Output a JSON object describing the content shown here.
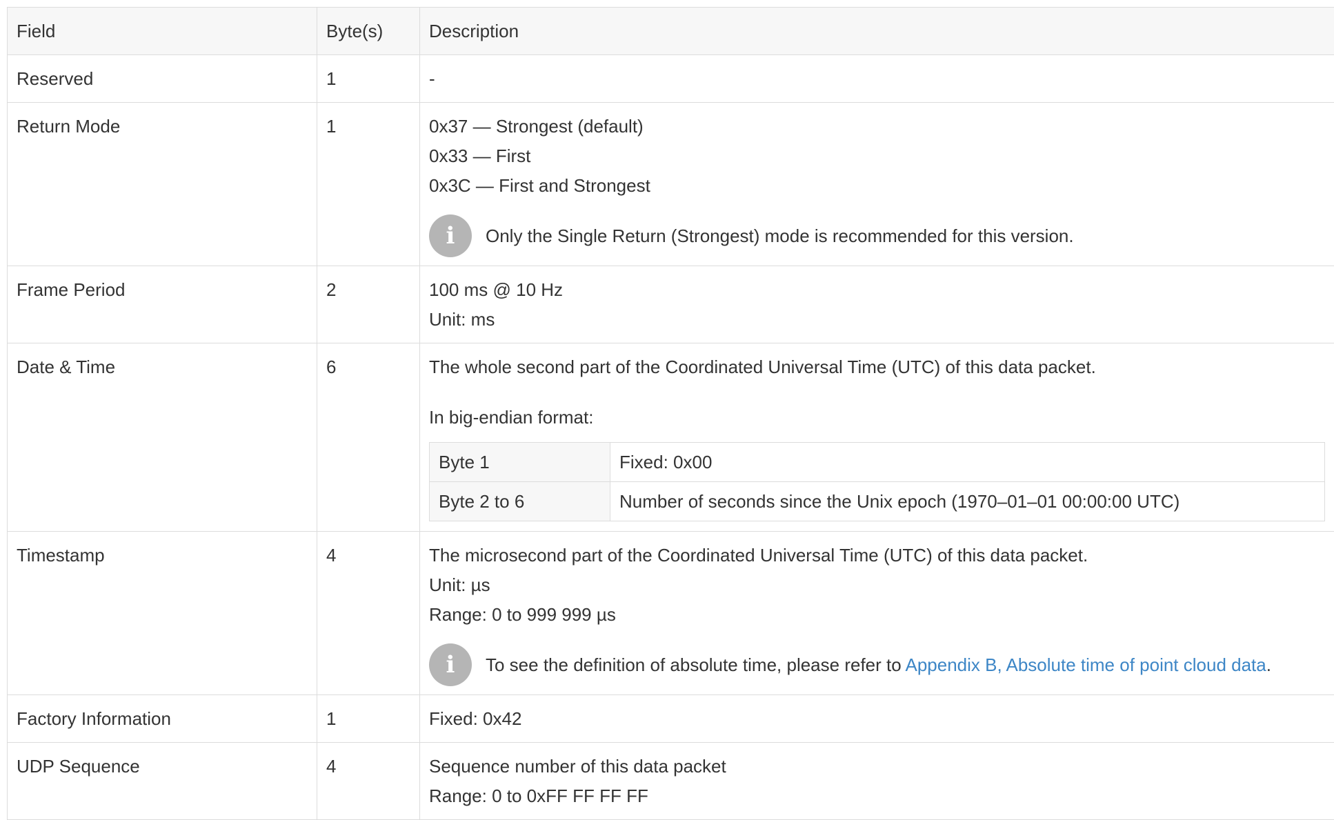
{
  "table": {
    "headers": {
      "field": "Field",
      "bytes": "Byte(s)",
      "description": "Description"
    },
    "rows": {
      "reserved": {
        "field": "Reserved",
        "bytes": "1",
        "description": "-"
      },
      "return_mode": {
        "field": "Return Mode",
        "bytes": "1",
        "lines": [
          "0x37 — Strongest (default)",
          "0x33 — First",
          "0x3C — First and Strongest"
        ],
        "note": "Only the Single Return (Strongest) mode is recommended for this version.",
        "note_icon": "info-icon"
      },
      "frame_period": {
        "field": "Frame Period",
        "bytes": "2",
        "lines": [
          "100 ms @ 10 Hz",
          "Unit: ms"
        ]
      },
      "date_time": {
        "field": "Date & Time",
        "bytes": "6",
        "paragraph1": "The whole second part of the Coordinated Universal Time (UTC) of this data packet.",
        "paragraph2": "In big-endian format:",
        "subtable": [
          {
            "key": "Byte 1",
            "value": "Fixed: 0x00"
          },
          {
            "key": "Byte 2 to 6",
            "value": "Number of seconds since the Unix epoch (1970–01–01 00:00:00 UTC)"
          }
        ]
      },
      "timestamp": {
        "field": "Timestamp",
        "bytes": "4",
        "lines": [
          "The microsecond part of the Coordinated Universal Time (UTC) of this data packet.",
          "Unit: µs",
          "Range: 0 to 999 999 µs"
        ],
        "note_prefix": "To see the definition of absolute time, please refer to ",
        "note_link": "Appendix B, Absolute time of point cloud data",
        "note_suffix": ".",
        "note_icon": "info-icon"
      },
      "factory_information": {
        "field": "Factory Information",
        "bytes": "1",
        "description": "Fixed: 0x42"
      },
      "udp_sequence": {
        "field": "UDP Sequence",
        "bytes": "4",
        "lines": [
          "Sequence number of this data packet",
          "Range: 0 to 0xFF FF FF FF"
        ]
      }
    }
  },
  "colors": {
    "link": "#3d86c6",
    "border": "#dcdcdc",
    "header_bg": "#f7f7f7",
    "info_icon_bg": "#b5b5b5",
    "text": "#333333"
  }
}
